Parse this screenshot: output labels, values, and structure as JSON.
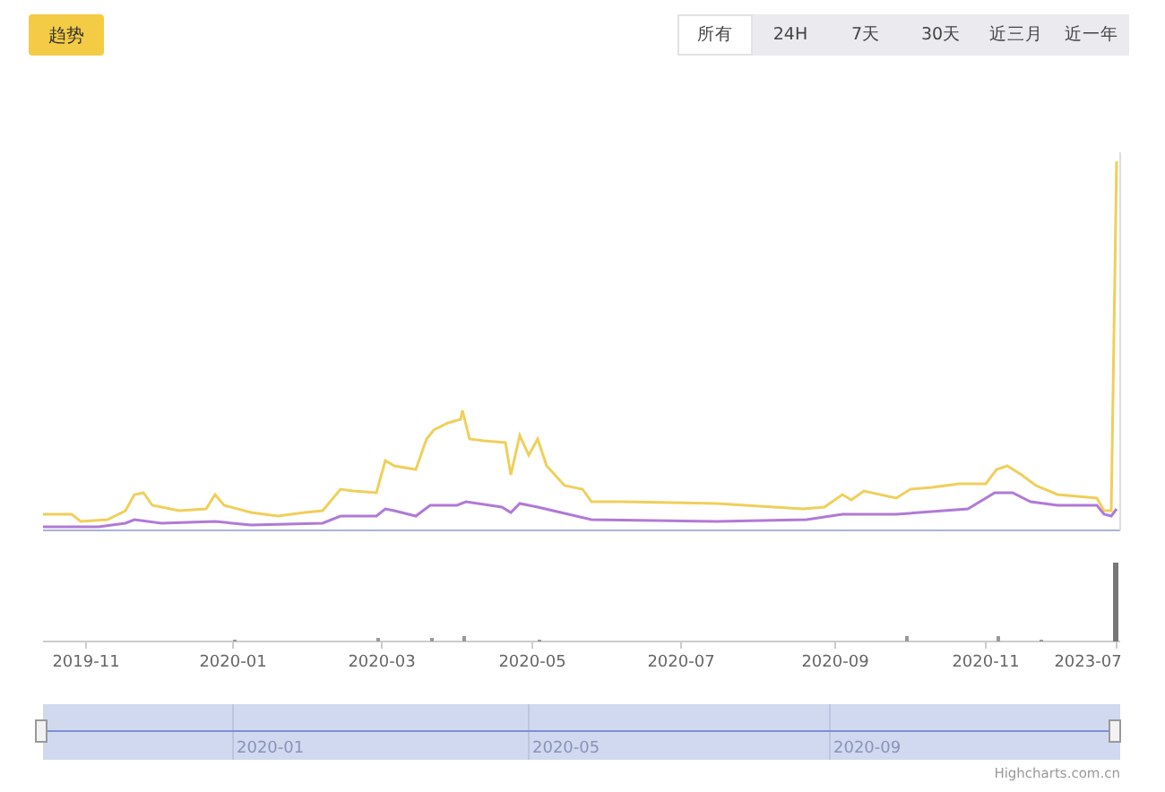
{
  "trend_button": {
    "label": "趋势"
  },
  "range_tabs": [
    {
      "label": "所有",
      "selected": true
    },
    {
      "label": "24H",
      "selected": false
    },
    {
      "label": "7天",
      "selected": false
    },
    {
      "label": "30天",
      "selected": false
    },
    {
      "label": "近三月",
      "selected": false
    },
    {
      "label": "近一年",
      "selected": false
    }
  ],
  "x_axis": {
    "labels": [
      "2019-11",
      "2020-01",
      "2020-03",
      "2020-05",
      "2020-07",
      "2020-09",
      "2020-11",
      "2023-07"
    ]
  },
  "navigator": {
    "labels": [
      "2020-01",
      "2020-05",
      "2020-09"
    ]
  },
  "credit": "Highcharts.com.cn"
}
